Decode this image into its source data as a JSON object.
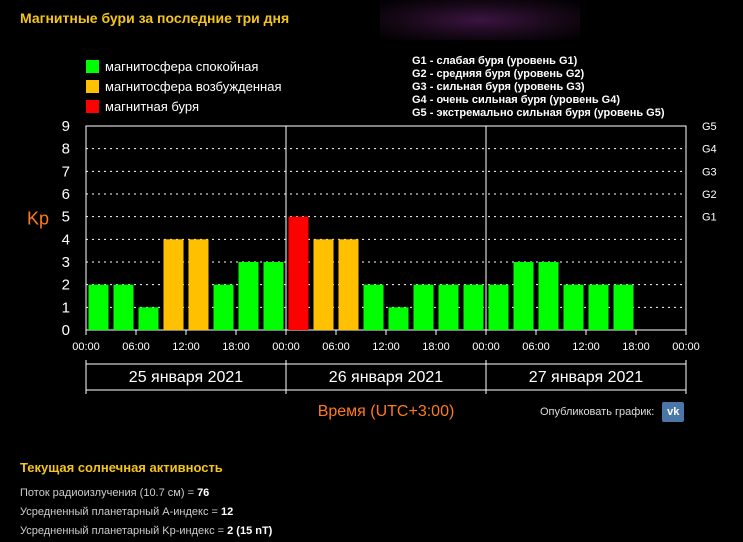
{
  "page": {
    "title": "Магнитные бури за последние три дня",
    "publish_label": "Опубликовать график:",
    "vk_label": "vk"
  },
  "legend": [
    {
      "label": "магнитосфера спокойная",
      "color": "#00ff00"
    },
    {
      "label": "магнитосфера возбужденная",
      "color": "#ffc000"
    },
    {
      "label": "магнитная буря",
      "color": "#ff0000"
    }
  ],
  "storm_legend": [
    "G1 - слабая буря (уровень G1)",
    "G2 - средняя буря (уровень G2)",
    "G3 - сильная буря (уровень G3)",
    "G4 - очень сильная буря (уровень G4)",
    "G5 - экстремально сильная буря (уровень G5)"
  ],
  "chart_data": {
    "type": "bar",
    "ylabel": "Kp",
    "xlabel": "Время (UTC+3:00)",
    "ylim": [
      0,
      9
    ],
    "yticks": [
      "0",
      "1",
      "2",
      "3",
      "4",
      "5",
      "6",
      "7",
      "8",
      "9"
    ],
    "right_ticks": [
      {
        "label": "G1",
        "value": 5
      },
      {
        "label": "G2",
        "value": 6
      },
      {
        "label": "G3",
        "value": 7
      },
      {
        "label": "G4",
        "value": 8
      },
      {
        "label": "G5",
        "value": 9
      }
    ],
    "xtick_labels": [
      "00:00",
      "06:00",
      "12:00",
      "18:00",
      "00:00",
      "06:00",
      "12:00",
      "18:00",
      "00:00",
      "06:00",
      "12:00",
      "18:00",
      "00:00"
    ],
    "days": [
      "25 января 2021",
      "26 января 2021",
      "27 января 2021"
    ],
    "values": [
      2,
      2,
      1,
      4,
      4,
      2,
      3,
      3,
      5,
      4,
      4,
      2,
      1,
      2,
      2,
      2,
      2,
      3,
      3,
      2,
      2,
      2
    ],
    "colors": {
      "quiet": "#00ff00",
      "active": "#ffc000",
      "storm": "#ff0000"
    },
    "grid": true
  },
  "activity": {
    "title": "Текущая солнечная активность",
    "lines": [
      {
        "label": "Поток радиоизлучения (10.7 см) = ",
        "value": "76"
      },
      {
        "label": "Усредненный планетарный A-индекс = ",
        "value": "12"
      },
      {
        "label": "Усредненный планетарный Kp-индекс = ",
        "value": "2 (15 nT)"
      }
    ]
  }
}
